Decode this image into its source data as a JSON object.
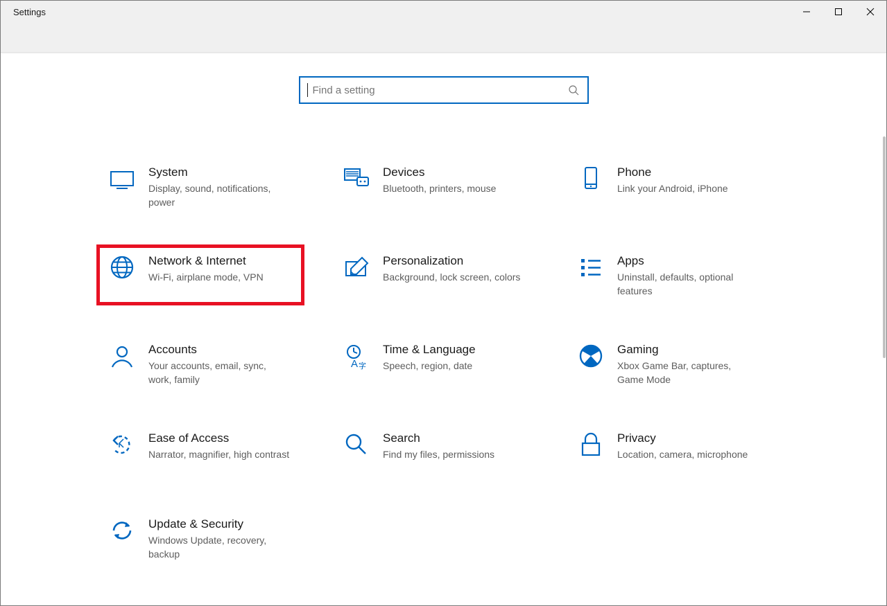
{
  "window": {
    "title": "Settings"
  },
  "search": {
    "placeholder": "Find a setting"
  },
  "tiles": [
    {
      "key": "system",
      "title": "System",
      "desc": "Display, sound, notifications, power",
      "icon": "system-icon",
      "highlight": false
    },
    {
      "key": "devices",
      "title": "Devices",
      "desc": "Bluetooth, printers, mouse",
      "icon": "devices-icon",
      "highlight": false
    },
    {
      "key": "phone",
      "title": "Phone",
      "desc": "Link your Android, iPhone",
      "icon": "phone-icon",
      "highlight": false
    },
    {
      "key": "network",
      "title": "Network & Internet",
      "desc": "Wi-Fi, airplane mode, VPN",
      "icon": "network-icon",
      "highlight": true
    },
    {
      "key": "personalization",
      "title": "Personalization",
      "desc": "Background, lock screen, colors",
      "icon": "personalization-icon",
      "highlight": false
    },
    {
      "key": "apps",
      "title": "Apps",
      "desc": "Uninstall, defaults, optional features",
      "icon": "apps-icon",
      "highlight": false
    },
    {
      "key": "accounts",
      "title": "Accounts",
      "desc": "Your accounts, email, sync, work, family",
      "icon": "accounts-icon",
      "highlight": false
    },
    {
      "key": "time",
      "title": "Time & Language",
      "desc": "Speech, region, date",
      "icon": "time-icon",
      "highlight": false
    },
    {
      "key": "gaming",
      "title": "Gaming",
      "desc": "Xbox Game Bar, captures, Game Mode",
      "icon": "gaming-icon",
      "highlight": false
    },
    {
      "key": "ease",
      "title": "Ease of Access",
      "desc": "Narrator, magnifier, high contrast",
      "icon": "ease-icon",
      "highlight": false
    },
    {
      "key": "search",
      "title": "Search",
      "desc": "Find my files, permissions",
      "icon": "search-category-icon",
      "highlight": false
    },
    {
      "key": "privacy",
      "title": "Privacy",
      "desc": "Location, camera, microphone",
      "icon": "privacy-icon",
      "highlight": false
    },
    {
      "key": "update",
      "title": "Update & Security",
      "desc": "Windows Update, recovery, backup",
      "icon": "update-icon",
      "highlight": false
    }
  ]
}
